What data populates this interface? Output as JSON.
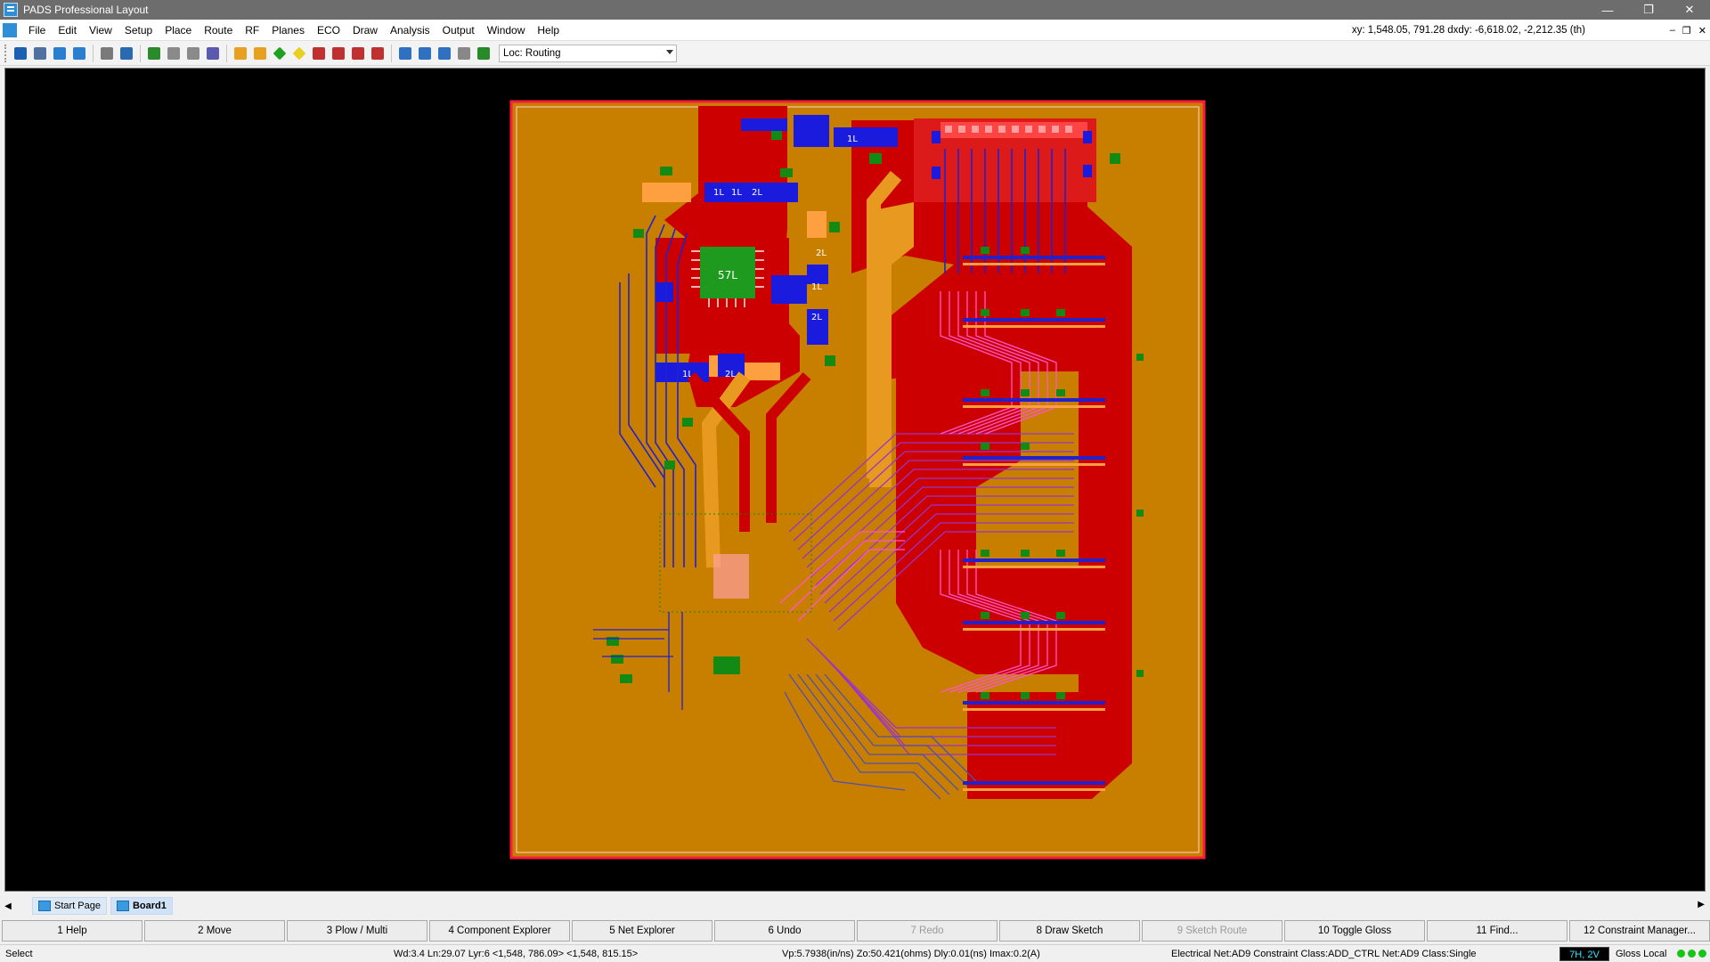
{
  "window": {
    "title": "PADS Professional Layout",
    "controls": {
      "minimize": "—",
      "restore": "❐",
      "close": "✕"
    }
  },
  "menu": {
    "items": [
      "File",
      "Edit",
      "View",
      "Setup",
      "Place",
      "Route",
      "RF",
      "Planes",
      "ECO",
      "Draw",
      "Analysis",
      "Output",
      "Window",
      "Help"
    ],
    "coords": "xy: 1,548.05, 791.28  dxdy: -6,618.02, -2,212.35  (th)",
    "mdi_controls": [
      "–",
      "❐",
      "✕"
    ]
  },
  "toolbar": {
    "icons": [
      "save-icon",
      "find-icon",
      "undo-icon",
      "redo-icon",
      "place-icon",
      "move-icon",
      "board-outline-icon",
      "route-icon",
      "plow-icon",
      "fanout-icon",
      "gloss-icon",
      "tune-icon",
      "drc-diamond-icon",
      "warning-diamond-icon",
      "drc-icon",
      "check-icon",
      "rev-icon",
      "review-icon",
      "zoom-icon",
      "copy-icon",
      "select-icon",
      "print-icon",
      "verify-icon"
    ],
    "loc_value": "Loc: Routing"
  },
  "canvas": {
    "background_color": "#000000",
    "board_color": "#c87f00",
    "outline_color": "#ff1a3c",
    "plane_color": "#cc0000",
    "trace_colors": [
      "#1b1bcc",
      "#cc33cc",
      "#ff66cc",
      "#e08a00",
      "#ffa040",
      "#008000"
    ],
    "ref_labels": [
      "57L",
      "2L",
      "1L",
      "1L",
      "2L",
      "2L",
      "1L",
      "1L",
      "2L",
      "1L"
    ]
  },
  "tabs": [
    {
      "label": "Start Page"
    },
    {
      "label": "Board1"
    }
  ],
  "fkeys": [
    {
      "label": "1 Help",
      "enabled": true
    },
    {
      "label": "2 Move",
      "enabled": true
    },
    {
      "label": "3 Plow / Multi",
      "enabled": true
    },
    {
      "label": "4 Component Explorer",
      "enabled": true
    },
    {
      "label": "5 Net Explorer",
      "enabled": true
    },
    {
      "label": "6 Undo",
      "enabled": true
    },
    {
      "label": "7 Redo",
      "enabled": false
    },
    {
      "label": "8 Draw Sketch",
      "enabled": true
    },
    {
      "label": "9 Sketch Route",
      "enabled": false
    },
    {
      "label": "10 Toggle Gloss",
      "enabled": true
    },
    {
      "label": "11 Find...",
      "enabled": true
    },
    {
      "label": "12 Constraint Manager...",
      "enabled": true
    }
  ],
  "status": {
    "mode": "Select",
    "cursor": "Wd:3.4 Ln:29.07 Lyr:6  <1,548, 786.09> <1,548, 815.15>",
    "electrical": "Vp:5.7938(in/ns) Zo:50.421(ohms) Dly:0.01(ns) Imax:0.2(A)",
    "net": "Electrical Net:AD9 Constraint Class:ADD_CTRL Net:AD9 Class:Single",
    "layers": "7H, 2V",
    "gloss": "Gloss Local"
  }
}
